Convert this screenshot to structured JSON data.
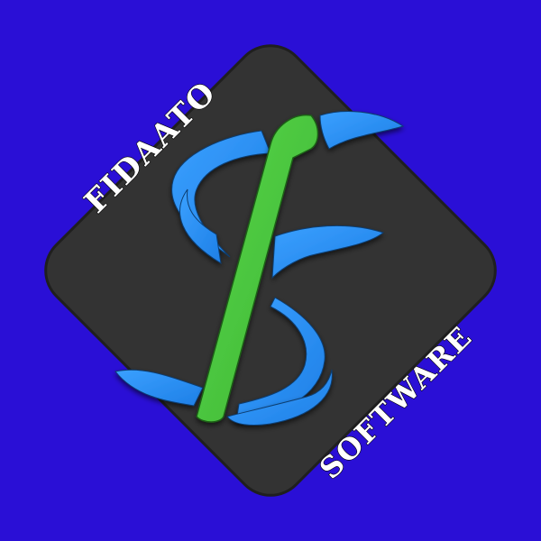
{
  "brand": {
    "top_text": "FIDAATO",
    "bottom_text": "SOFTWARE",
    "background_color": "#2a0fd6",
    "badge_color": "#333333",
    "primary_blue": "#2b8cf2",
    "accent_green": "#47c63d",
    "text_color": "#ffffff"
  }
}
